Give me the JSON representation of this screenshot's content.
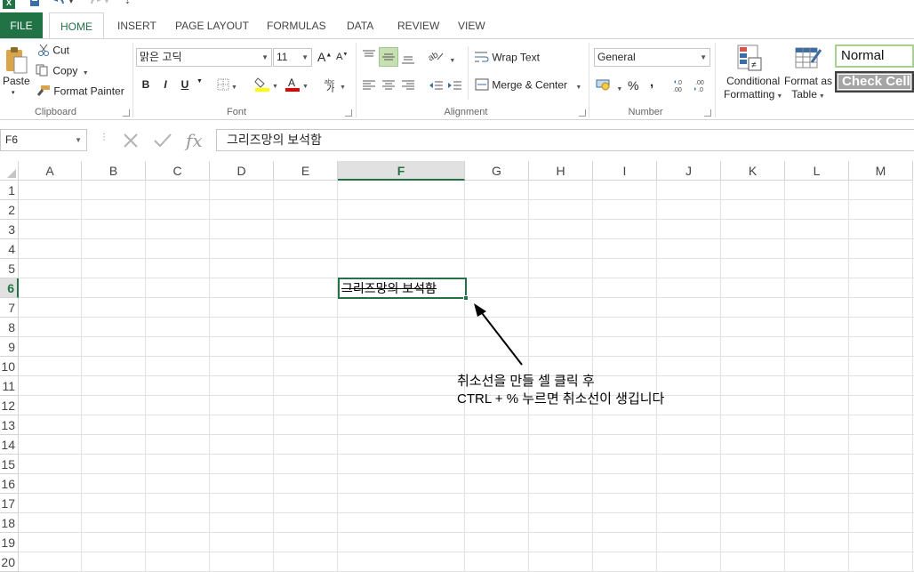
{
  "quick_access": {
    "app_icon": "X",
    "save_icon": "save-icon",
    "undo_icon": "undo-icon",
    "redo_icon": "redo-icon"
  },
  "tabs": [
    "FILE",
    "HOME",
    "INSERT",
    "PAGE LAYOUT",
    "FORMULAS",
    "DATA",
    "REVIEW",
    "VIEW"
  ],
  "active_tab": "HOME",
  "clipboard": {
    "paste": "Paste",
    "cut": "Cut",
    "copy": "Copy",
    "format_painter": "Format Painter",
    "label": "Clipboard"
  },
  "font": {
    "family": "맑은 고딕",
    "size": "11",
    "bold": "B",
    "italic": "I",
    "underline": "U",
    "grow": "A",
    "shrink": "A",
    "label": "Font",
    "font_color": "#e00000",
    "highlight_color": "#ffff00"
  },
  "alignment": {
    "wrap_text": "Wrap Text",
    "merge_center": "Merge & Center",
    "label": "Alignment"
  },
  "number": {
    "format": "General",
    "percent": "%",
    "comma": ",",
    "label": "Number"
  },
  "styles": {
    "conditional_1": "Conditional",
    "conditional_2": "Formatting",
    "format_table_1": "Format as",
    "format_table_2": "Table",
    "normal": "Normal",
    "check_cell": "Check Cell"
  },
  "formula_bar": {
    "name_box": "F6",
    "content": "그리즈망의 보석함"
  },
  "columns": [
    "A",
    "B",
    "C",
    "D",
    "E",
    "F",
    "G",
    "H",
    "I",
    "J",
    "K",
    "L",
    "M"
  ],
  "rows": [
    "1",
    "2",
    "3",
    "4",
    "5",
    "6",
    "7",
    "8",
    "9",
    "10",
    "11",
    "12",
    "13",
    "14",
    "15",
    "16",
    "17",
    "18",
    "19",
    "20"
  ],
  "active_cell": {
    "column": "F",
    "row": "6",
    "value": "그리즈망의 보석함"
  },
  "annotation": {
    "line1": "취소선을 만들 셀 클릭 후",
    "line2": "CTRL + % 누르면 취소선이 생깁니다"
  },
  "accent_color": "#217346"
}
